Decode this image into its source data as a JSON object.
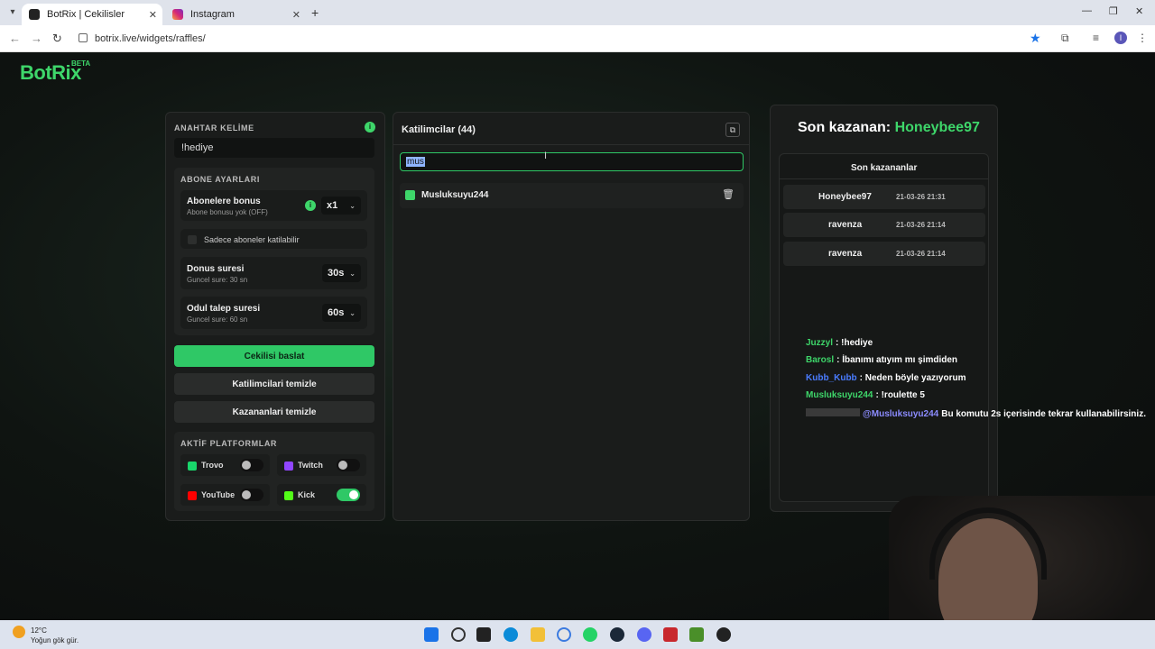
{
  "browser": {
    "tabs": [
      {
        "title": "BotRix | Cekilisler",
        "active": true
      },
      {
        "title": "Instagram",
        "active": false
      }
    ],
    "url": "botrix.live/widgets/raffles/",
    "profile_initial": "I"
  },
  "app": {
    "logo": "BotRix",
    "beta": "BETA"
  },
  "settings": {
    "keyword_label": "ANAHTAR KELİME",
    "keyword_value": "!hediye",
    "sub_settings_label": "ABONE AYARLARI",
    "sub_bonus_title": "Abonelere bonus",
    "sub_bonus_sub": "Abone bonusu yok (OFF)",
    "sub_bonus_value": "x1",
    "only_subs_label": "Sadece aboneler katilabilir",
    "bonus_time_title": "Donus suresi",
    "bonus_time_sub": "Guncel sure: 30 sn",
    "bonus_time_value": "30s",
    "claim_time_title": "Odul talep suresi",
    "claim_time_sub": "Guncel sure: 60 sn",
    "claim_time_value": "60s",
    "start_button": "Cekilisi baslat",
    "clear_participants_button": "Katilimcilari temizle",
    "clear_winners_button": "Kazananlari temizle",
    "platforms_label": "AKTİF PLATFORMLAR",
    "platforms": [
      {
        "name": "Trovo",
        "color": "#19d66b",
        "enabled": false
      },
      {
        "name": "Twitch",
        "color": "#9146ff",
        "enabled": false
      },
      {
        "name": "YouTube",
        "color": "#ff0000",
        "enabled": false
      },
      {
        "name": "Kick",
        "color": "#53fc18",
        "enabled": true
      }
    ]
  },
  "participants": {
    "title": "Katilimcilar (44)",
    "search_value": "mus",
    "list": [
      "Musluksuyu244"
    ]
  },
  "winners": {
    "last_winner_label": "Son kazanan:",
    "last_winner_name": "Honeybee97",
    "recent_label": "Son kazananlar",
    "rows": [
      {
        "name": "Honeybee97",
        "date": "21-03-26 21:31"
      },
      {
        "name": "ravenza",
        "date": "21-03-26 21:14"
      },
      {
        "name": "ravenza",
        "date": "21-03-26 21:14"
      }
    ]
  },
  "chat": [
    {
      "user": "Juzzyl",
      "color": "#3ed66a",
      "text": ": !hediye"
    },
    {
      "user": "Barosl",
      "color": "#3ed66a",
      "text": ": İbanımı atıyım mı şimdiden"
    },
    {
      "user": "Kubb_Kubb",
      "color": "#4a7cff",
      "text": ": Neden böyle yazıyorum"
    },
    {
      "user": "Musluksuyu244",
      "color": "#3ed66a",
      "text": ": !roulette 5"
    },
    {
      "user": "@Musluksuyu244",
      "color": "#8c8cff",
      "text": "Bu komutu 2s içerisinde tekrar kullanabilirsiniz."
    }
  ],
  "taskbar": {
    "temp": "12°C",
    "weather": "Yoğun gök gür."
  }
}
